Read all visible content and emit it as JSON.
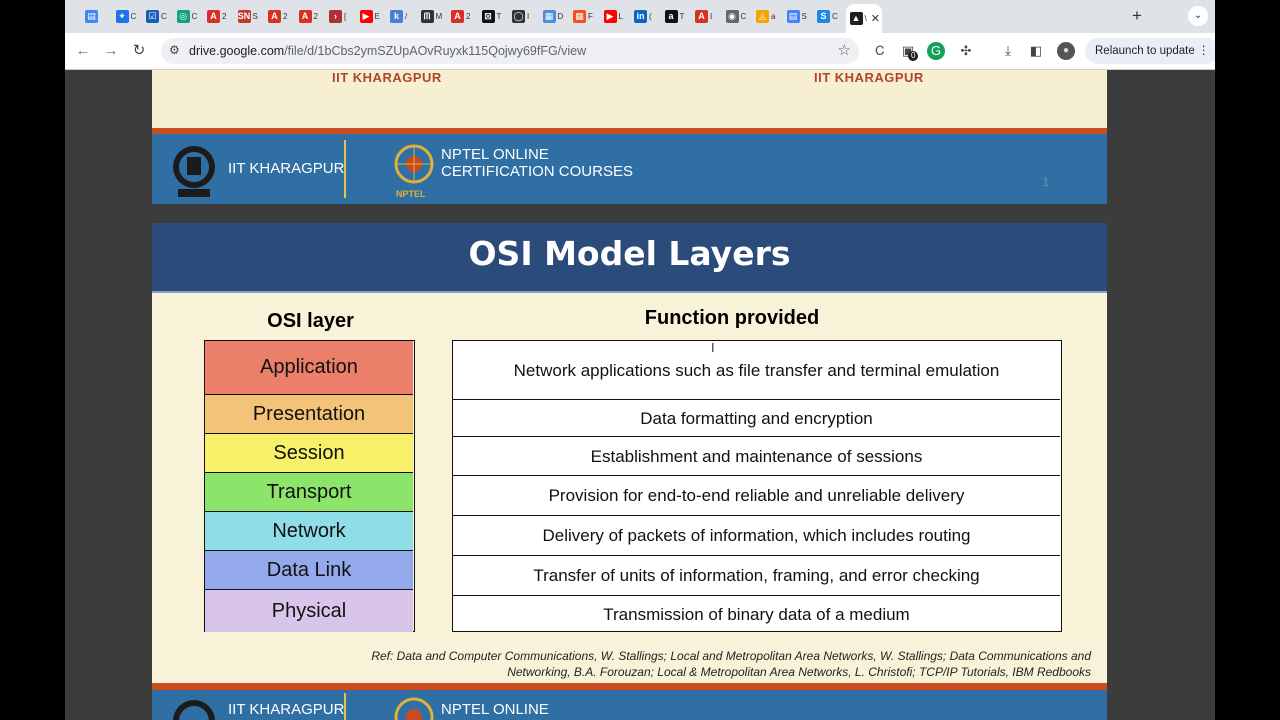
{
  "browser": {
    "tabs": [
      {
        "glyph": "▤",
        "color": "#4285f4",
        "text": ""
      },
      {
        "glyph": "✦",
        "color": "#1a73e8",
        "text": "C"
      },
      {
        "glyph": "☑",
        "color": "#1a5fb4",
        "text": "C"
      },
      {
        "glyph": "◎",
        "color": "#10a37f",
        "text": "C"
      },
      {
        "glyph": "A",
        "color": "#d93025",
        "text": "2"
      },
      {
        "glyph": "SN",
        "color": "#c0392b",
        "text": "S"
      },
      {
        "glyph": "A",
        "color": "#d93025",
        "text": "2"
      },
      {
        "glyph": "A",
        "color": "#d93025",
        "text": "2"
      },
      {
        "glyph": "›",
        "color": "#b03030",
        "text": "["
      },
      {
        "glyph": "▶",
        "color": "#ff0000",
        "text": "E"
      },
      {
        "glyph": "k",
        "color": "#4a7fd8",
        "text": "/"
      },
      {
        "glyph": "ᗰ",
        "color": "#333333",
        "text": "M"
      },
      {
        "glyph": "A",
        "color": "#d93025",
        "text": "2"
      },
      {
        "glyph": "⊠",
        "color": "#111111",
        "text": "T"
      },
      {
        "glyph": "◯",
        "color": "#333333",
        "text": "I"
      },
      {
        "glyph": "▦",
        "color": "#4a90d9",
        "text": "D"
      },
      {
        "glyph": "▦",
        "color": "#f25022",
        "text": "F"
      },
      {
        "glyph": "▶",
        "color": "#ff0000",
        "text": "L"
      },
      {
        "glyph": "in",
        "color": "#0a66c2",
        "text": "("
      },
      {
        "glyph": "a",
        "color": "#111111",
        "text": "T"
      },
      {
        "glyph": "A",
        "color": "#d93025",
        "text": "I"
      },
      {
        "glyph": "◉",
        "color": "#666666",
        "text": "C"
      },
      {
        "glyph": "◬",
        "color": "#f4a300",
        "text": "a"
      },
      {
        "glyph": "▤",
        "color": "#4285f4",
        "text": "S"
      },
      {
        "glyph": "S",
        "color": "#1e88e5",
        "text": "C"
      }
    ],
    "active_tab": {
      "glyph": "▲",
      "color": "#1f1f1f",
      "text": "\\",
      "close": "✕"
    },
    "new_tab_label": "+",
    "tab_menu_label": "⌄",
    "url_host": "drive.google.com",
    "url_path": "/file/d/1bCbs2ymSZUpAOvRuyxk115Qojwy69fFG/view",
    "extension_badge": "0",
    "relaunch_label": "Relaunch to update"
  },
  "previous_slide": {
    "institute_label_left": "IIT KHARAGPUR",
    "institute_label_right": "IIT KHARAGPUR",
    "footer_institute": "IIT KHARAGPUR",
    "footer_course_line1": "NPTEL ONLINE",
    "footer_course_line2": "CERTIFICATION COURSES",
    "npt_logo_text": "NPTEL",
    "page_number": "1"
  },
  "slide": {
    "title": "OSI Model Layers",
    "column_osi": "OSI layer",
    "column_function": "Function provided",
    "layers": [
      {
        "name": "Application",
        "color": "#ec7f69"
      },
      {
        "name": "Presentation",
        "color": "#f3c477"
      },
      {
        "name": "Session",
        "color": "#f7f16a"
      },
      {
        "name": "Transport",
        "color": "#8ce46a"
      },
      {
        "name": "Network",
        "color": "#8fdde6"
      },
      {
        "name": "Data Link",
        "color": "#94a8ec"
      },
      {
        "name": "Physical",
        "color": "#d9c5ea"
      }
    ],
    "functions": [
      "Network applications such as file transfer and terminal emulation",
      "Data formatting and encryption",
      "Establishment and maintenance of sessions",
      "Provision for end-to-end reliable and unreliable delivery",
      "Delivery of packets of information, which includes routing",
      "Transfer of units of information, framing, and error checking",
      "Transmission of binary data of a medium"
    ],
    "reference_line1": "Ref: Data and Computer Communications, W. Stallings; Local and Metropolitan Area Networks, W. Stallings; Data Communications and",
    "reference_line2": "Networking, B.A. Forouzan; Local & Metropolitan  Area Networks, L. Christofi; TCP/IP Tutorials, IBM Redbooks"
  },
  "next_slide": {
    "footer_institute": "IIT KHARAGPUR",
    "footer_course_line1": "NPTEL ONLINE"
  }
}
